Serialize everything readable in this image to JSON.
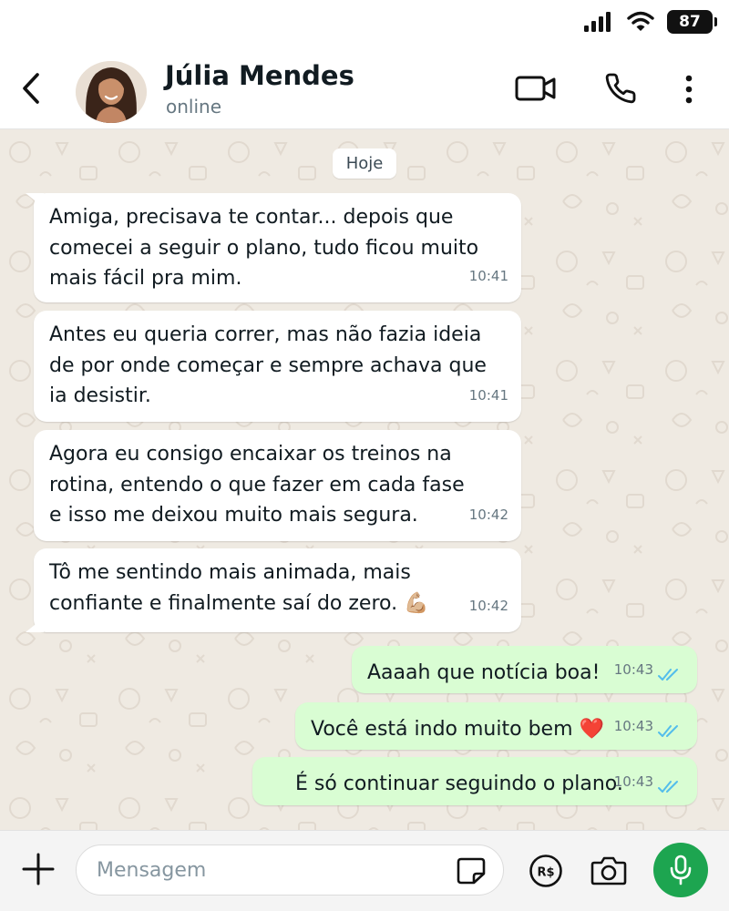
{
  "status_bar": {
    "battery": "87"
  },
  "header": {
    "contact_name": "Júlia Mendes",
    "contact_status": "online"
  },
  "chat": {
    "date_label": "Hoje",
    "incoming": [
      {
        "lines": [
          "Amiga, precisava te contar... depois que",
          "comecei a seguir o plano, tudo ficou muito",
          "mais fácil pra mim."
        ],
        "time": "10:41"
      },
      {
        "lines": [
          "Antes eu queria correr, mas não fazia ideia",
          "de por onde começar e sempre achava que",
          "ia desistir."
        ],
        "time": "10:41"
      },
      {
        "lines": [
          "Agora eu consigo encaixar os treinos na",
          "rotina, entendo o que fazer em cada fase",
          "e isso me deixou muito mais segura."
        ],
        "time": "10:42"
      },
      {
        "lines": [
          "Tô me sentindo mais animada, mais",
          "confiante e finalmente saí do zero. 💪🏼"
        ],
        "time": "10:42"
      }
    ],
    "outgoing": [
      {
        "text": "Aaaah que notícia boa!",
        "time": "10:43",
        "status": "read"
      },
      {
        "text": "Você está indo muito bem ❤️",
        "time": "10:43",
        "status": "read"
      },
      {
        "text": "É só continuar seguindo o plano.",
        "time": "10:43",
        "status": "read"
      }
    ]
  },
  "input_bar": {
    "placeholder": "Mensagem"
  },
  "colors": {
    "chat_background": "#efeae2",
    "incoming_bubble": "#ffffff",
    "outgoing_bubble": "#d9fdd3",
    "read_ticks": "#53bdeb",
    "mic_button": "#1da550"
  },
  "icons": [
    "cellular-signal-icon",
    "wifi-icon",
    "battery-icon",
    "back-arrow-icon",
    "video-call-icon",
    "phone-icon",
    "more-options-icon",
    "plus-icon",
    "sticker-icon",
    "payment-icon",
    "camera-icon",
    "microphone-icon",
    "double-check-icon"
  ]
}
